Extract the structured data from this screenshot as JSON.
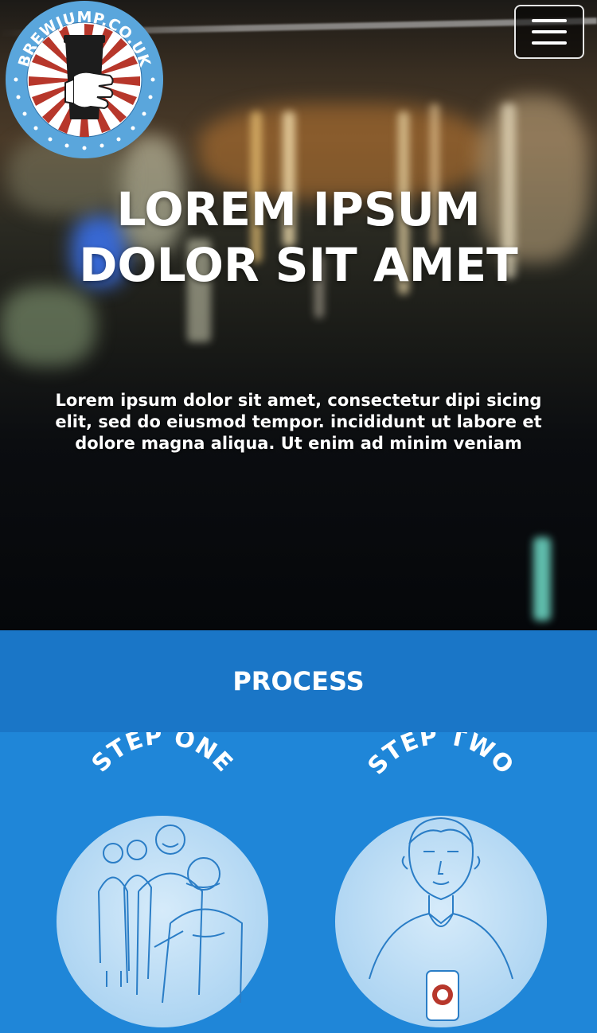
{
  "brand": {
    "logo_text": "BREWJUMP.CO.UK"
  },
  "header": {
    "menu_icon": "hamburger-menu-icon"
  },
  "hero": {
    "title": "LOREM IPSUM DOLOR SIT AMET",
    "subtitle": "Lorem ipsum dolor sit amet, consectetur dipi sicing elit, sed do eiusmod tempor. incididunt ut labore et dolore magna aliqua. Ut enim ad minim veniam"
  },
  "process": {
    "title": "PROCESS",
    "steps": [
      {
        "label": "STEP ONE",
        "illustration": "group-of-people-icon"
      },
      {
        "label": "STEP TWO",
        "illustration": "person-holding-cup-icon"
      }
    ]
  },
  "colors": {
    "process_bar": "#1a76c7",
    "steps_bg": "#1f86d8",
    "step_circle": "#b9dbf5",
    "step_line": "#2a7dc6",
    "logo_ring": "#5aa6dc",
    "logo_red": "#b7372b"
  }
}
